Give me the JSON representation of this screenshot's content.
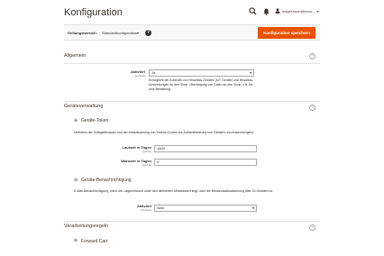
{
  "header": {
    "title": "Konfiguration",
    "user_name": "holger.koch@eccu..."
  },
  "scope": {
    "label": "Geltungsbereich:",
    "value": "Standardkonfiguration",
    "save_label": "Konfiguration speichern"
  },
  "allgemein": {
    "title": "Allgemein",
    "field_label": "Aktiviert",
    "field_scope": "[website]",
    "select_value": "Ja",
    "note": "Ermöglicht die Kontrolle von Headless-Geräten (IoT Geräte) und Headless Anwendungen an den Shop. Übertragung von Daten an den Shop, z.B. für eine Bestellung."
  },
  "geraeteverwaltung": {
    "title": "Geräteverwaltung",
    "token": {
      "title": "Geräte-Token",
      "description": "Definition der Gültigkeitsdauer und der Ablaufwarnung von Tokens (Codes zur Authentifizierung von Geräten und Anwendungen).",
      "laufzeit_label": "Laufzeit in Tagen",
      "laufzeit_scope": "[global]",
      "laufzeit_value": "1800",
      "warnzeit_label": "Warnzeit in Tagen",
      "warnzeit_scope": "[global]",
      "warnzeit_value": "5"
    },
    "benachrichtigung": {
      "title": "Geräte-Benachrichtigung",
      "description": "E-Mail-Benachrichtigung, wenn der Lagerbestand unter den definierten Mindestwert liegt, oder die Bestandsaktualisierung älter 24 Stunden ist.",
      "field_label": "Aktiviert",
      "field_scope": "[website]",
      "select_value": "Nein"
    }
  },
  "verarbeitungsregeln": {
    "title": "Verarbeitungsregeln",
    "sub_title": "Forward Cart"
  }
}
